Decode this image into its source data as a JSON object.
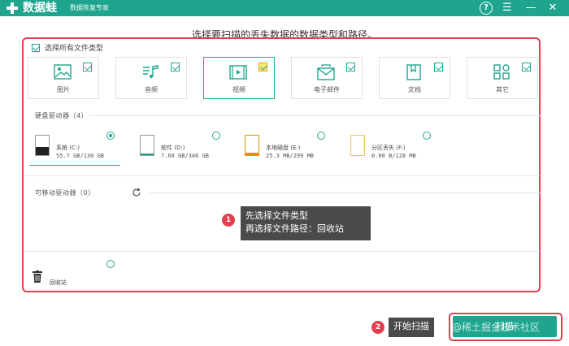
{
  "app": {
    "name": "数据蛙",
    "subtitle": "数据恢复专家"
  },
  "instruction": "选择要扫描的丢失数据的数据类型和路径。",
  "select_all": {
    "label": "选择所有文件类型",
    "checked": true
  },
  "file_types": [
    {
      "label": "图片",
      "icon": "image-icon",
      "checked": true,
      "selected": false
    },
    {
      "label": "音频",
      "icon": "music-icon",
      "checked": true,
      "selected": false
    },
    {
      "label": "视频",
      "icon": "video-icon",
      "checked": true,
      "selected": true
    },
    {
      "label": "电子邮件",
      "icon": "mail-icon",
      "checked": true,
      "selected": false
    },
    {
      "label": "文档",
      "icon": "document-icon",
      "checked": true,
      "selected": false
    },
    {
      "label": "其它",
      "icon": "other-icon",
      "checked": true,
      "selected": false
    }
  ],
  "hard_drives": {
    "title": "硬盘驱动器（4）",
    "items": [
      {
        "name": "系统 (C:)",
        "size": "55.7 GB/130 GB",
        "selected": true,
        "fill_color": "#222222"
      },
      {
        "name": "软件 (D:)",
        "size": "7.68 GB/346 GB",
        "selected": false,
        "fill_color": "#1fa58e"
      },
      {
        "name": "本地磁盘 (E:)",
        "size": "25.3 MB/299 MB",
        "selected": false,
        "fill_color": "#f08c00"
      },
      {
        "name": "分区丢失 (F:)",
        "size": "0.00  B/128 MB",
        "selected": false,
        "fill_color": "#f0c060"
      }
    ]
  },
  "removable": {
    "title": "可移动驱动器（0）"
  },
  "recycle_bin": {
    "label": "回收站",
    "selected": false
  },
  "callout1": {
    "number": "1",
    "line1": "先选择文件类型",
    "line2": "再选择文件路径：回收站"
  },
  "callout2": {
    "number": "2",
    "text": "开始扫描"
  },
  "start_button": {
    "label": "扫描"
  },
  "watermark": "@稀土掘金技术社区",
  "colors": {
    "accent": "#1fa58e",
    "highlight": "#e04050"
  }
}
